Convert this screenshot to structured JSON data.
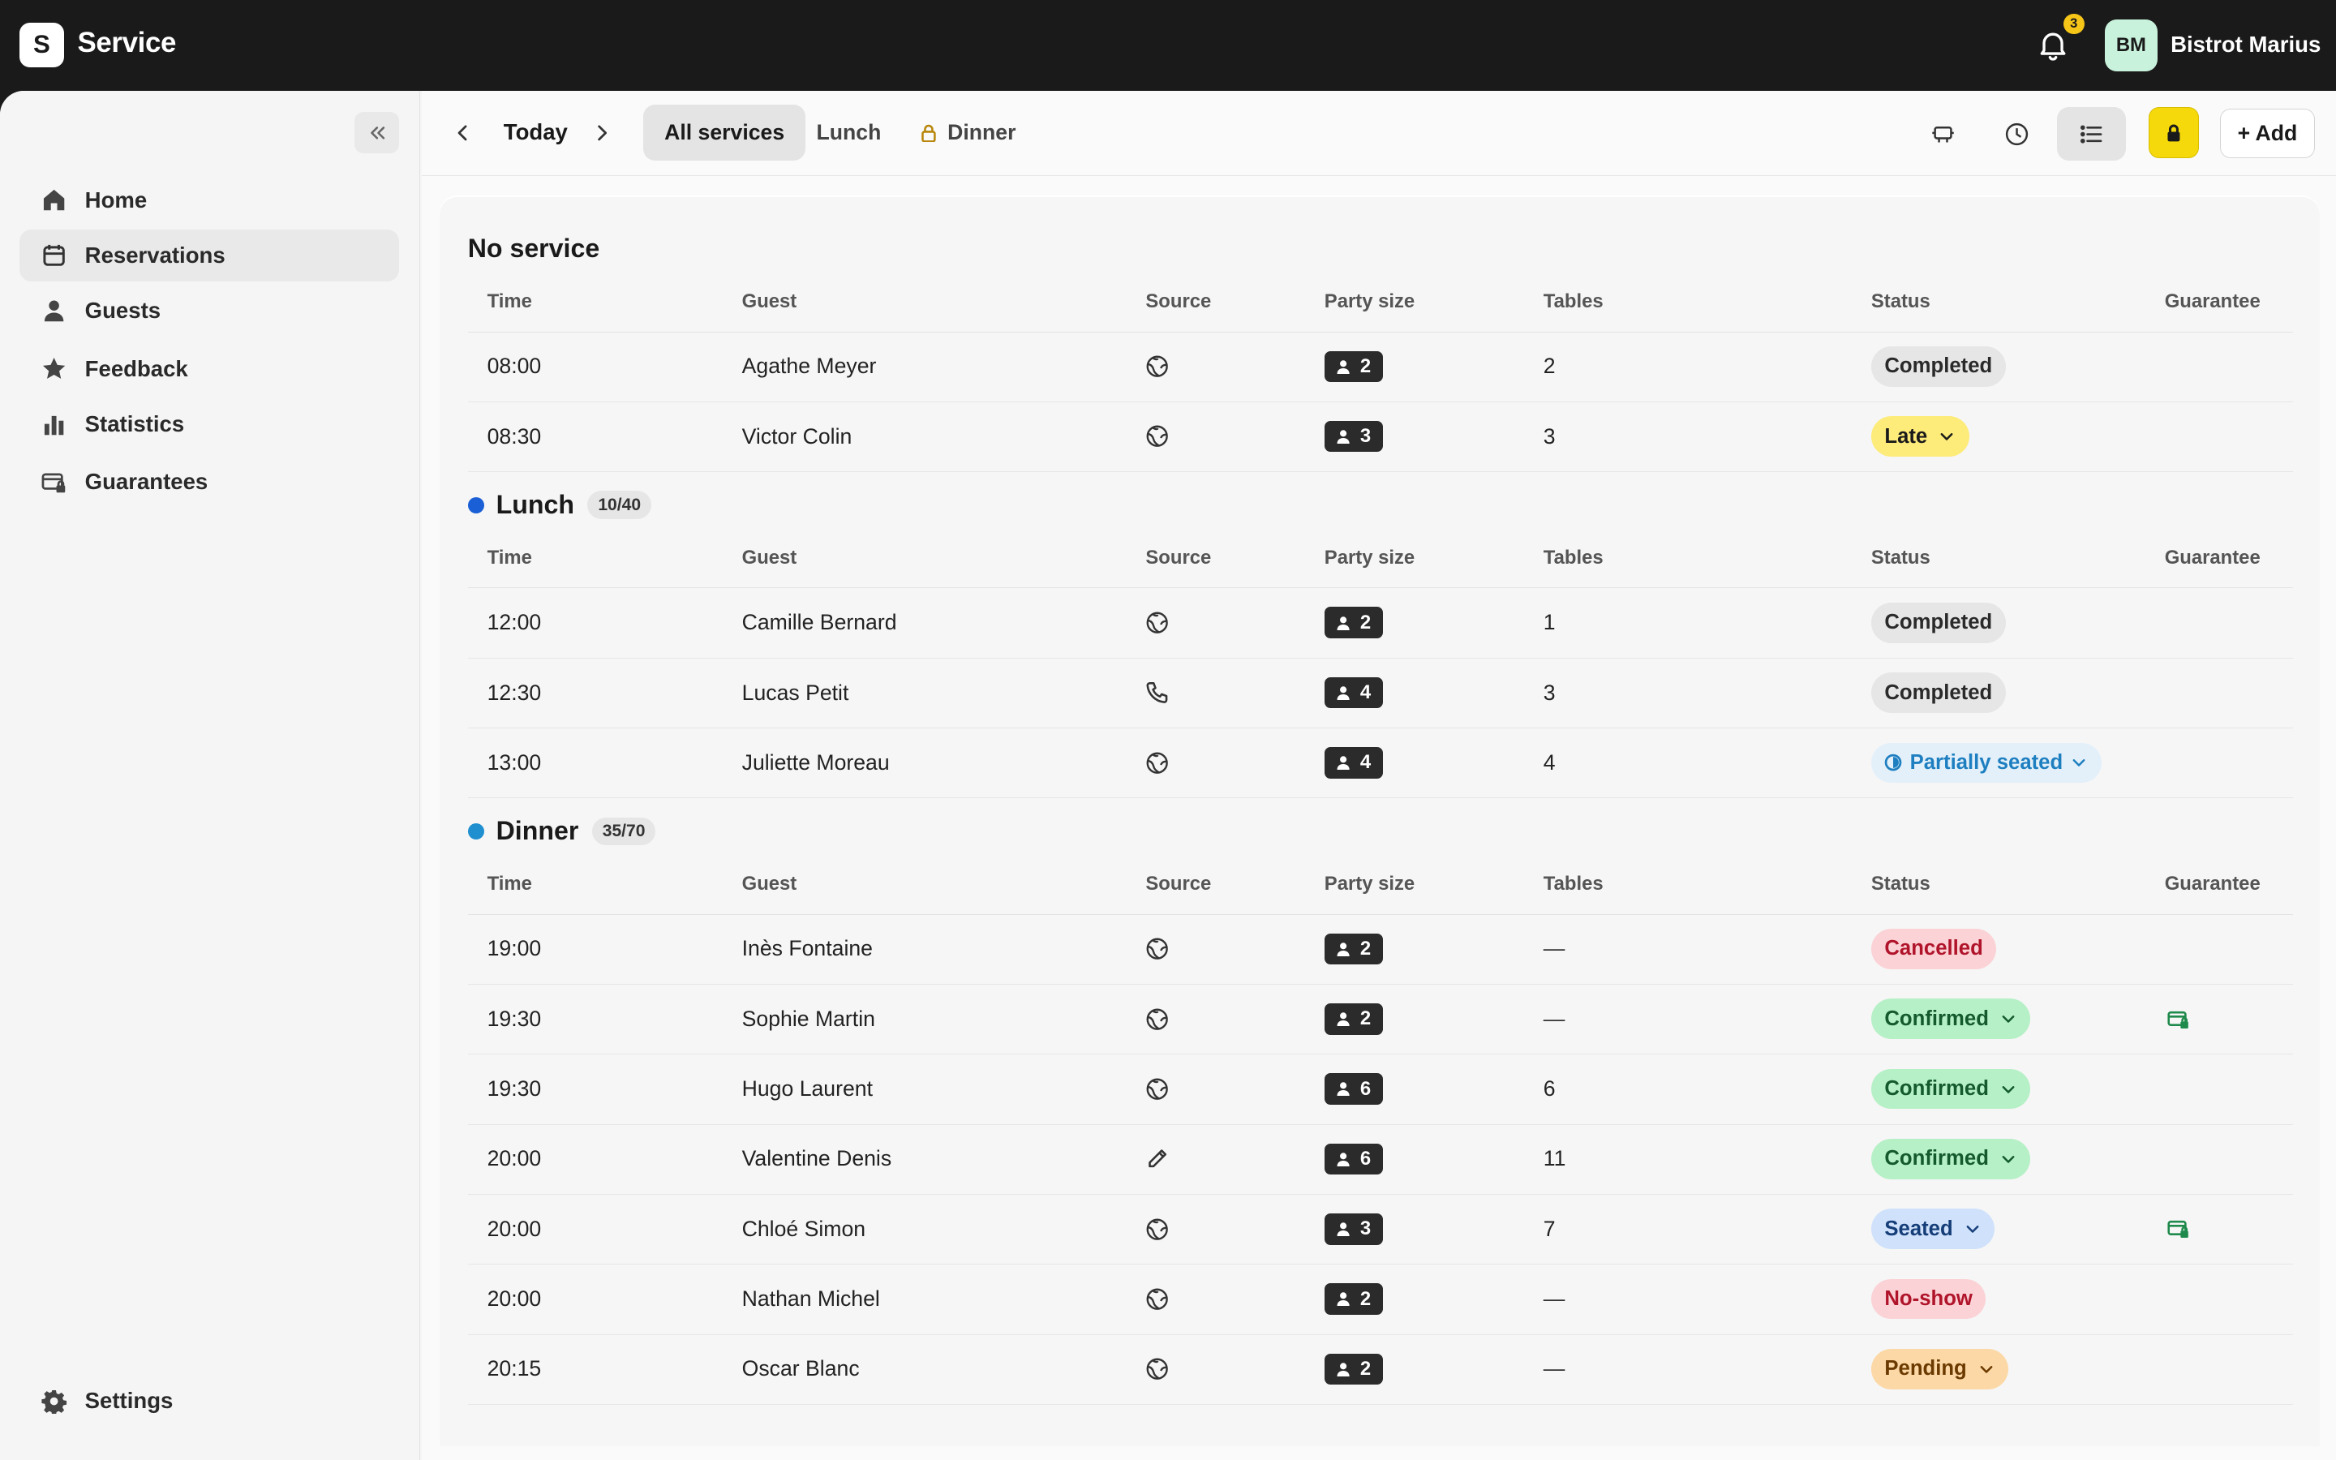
{
  "topbar": {
    "logo_letter": "S",
    "app_title": "Service",
    "notifications_count": "3",
    "avatar_initials": "BM",
    "user_name": "Bistrot Marius"
  },
  "sidebar": {
    "items": [
      {
        "label": "Home",
        "icon": "home-icon"
      },
      {
        "label": "Reservations",
        "icon": "calendar-icon",
        "active": true
      },
      {
        "label": "Guests",
        "icon": "person-icon"
      },
      {
        "label": "Feedback",
        "icon": "star-icon"
      },
      {
        "label": "Statistics",
        "icon": "bar-chart-icon"
      },
      {
        "label": "Guarantees",
        "icon": "card-lock-icon"
      }
    ],
    "settings_label": "Settings"
  },
  "toolbar": {
    "date_label": "Today",
    "tabs": [
      {
        "label": "All services",
        "active": true
      },
      {
        "label": "Lunch"
      },
      {
        "label": "Dinner",
        "locked": true
      }
    ],
    "add_label": "+ Add"
  },
  "columns": {
    "time": "Time",
    "guest": "Guest",
    "source": "Source",
    "party": "Party size",
    "tables": "Tables",
    "status": "Status",
    "guarantee": "Guarantee"
  },
  "colors": {
    "lunch_dot": "#1a5fd6",
    "dinner_dot": "#1f8fd0",
    "accent_yellow": "#f5d90a"
  },
  "sections": [
    {
      "title": "No service",
      "rows": [
        {
          "time": "08:00",
          "guest": "Agathe Meyer",
          "source": "web",
          "party": "2",
          "tables": "2",
          "status": "Completed",
          "status_type": "completed"
        },
        {
          "time": "08:30",
          "guest": "Victor Colin",
          "source": "web",
          "party": "3",
          "tables": "3",
          "status": "Late",
          "status_type": "late",
          "dropdown": true
        }
      ]
    },
    {
      "title": "Lunch",
      "count": "10/40",
      "rows": [
        {
          "time": "12:00",
          "guest": "Camille Bernard",
          "source": "web",
          "party": "2",
          "tables": "1",
          "status": "Completed",
          "status_type": "completed"
        },
        {
          "time": "12:30",
          "guest": "Lucas Petit",
          "source": "phone",
          "party": "4",
          "tables": "3",
          "status": "Completed",
          "status_type": "completed"
        },
        {
          "time": "13:00",
          "guest": "Juliette Moreau",
          "source": "web",
          "party": "4",
          "tables": "4",
          "status": "Partially seated",
          "status_type": "partial",
          "dropdown": true
        }
      ]
    },
    {
      "title": "Dinner",
      "count": "35/70",
      "rows": [
        {
          "time": "19:00",
          "guest": "Inès Fontaine",
          "source": "web",
          "party": "2",
          "tables": "—",
          "status": "Cancelled",
          "status_type": "cancelled"
        },
        {
          "time": "19:30",
          "guest": "Sophie Martin",
          "source": "web",
          "party": "2",
          "tables": "—",
          "status": "Confirmed",
          "status_type": "confirmed",
          "dropdown": true,
          "guarantee": true
        },
        {
          "time": "19:30",
          "guest": "Hugo Laurent",
          "source": "web",
          "party": "6",
          "tables": "6",
          "status": "Confirmed",
          "status_type": "confirmed",
          "dropdown": true
        },
        {
          "time": "20:00",
          "guest": "Valentine Denis",
          "source": "manual",
          "party": "6",
          "tables": "11",
          "status": "Confirmed",
          "status_type": "confirmed",
          "dropdown": true
        },
        {
          "time": "20:00",
          "guest": "Chloé Simon",
          "source": "web",
          "party": "3",
          "tables": "7",
          "status": "Seated",
          "status_type": "seated",
          "dropdown": true,
          "guarantee": true
        },
        {
          "time": "20:00",
          "guest": "Nathan Michel",
          "source": "web",
          "party": "2",
          "tables": "—",
          "status": "No-show",
          "status_type": "noshow"
        },
        {
          "time": "20:15",
          "guest": "Oscar Blanc",
          "source": "web",
          "party": "2",
          "tables": "—",
          "status": "Pending",
          "status_type": "pending",
          "dropdown": true
        }
      ]
    }
  ]
}
